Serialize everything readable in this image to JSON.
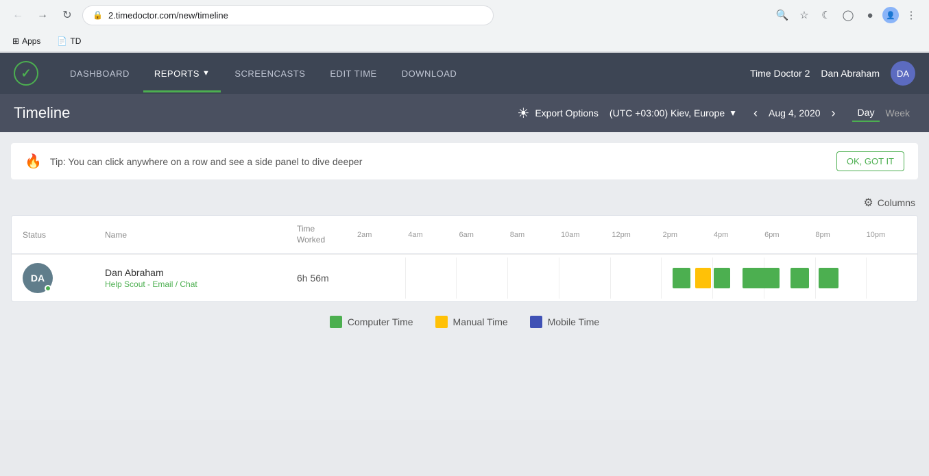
{
  "browser": {
    "url": "2.timedoctor.com/new/timeline",
    "bookmarks": [
      {
        "label": "Apps",
        "icon": "⊞"
      },
      {
        "label": "TD",
        "icon": "📄"
      }
    ],
    "menu_icon": "⋮"
  },
  "header": {
    "logo_check": "✓",
    "nav": [
      {
        "id": "dashboard",
        "label": "DASHBOARD",
        "active": false
      },
      {
        "id": "reports",
        "label": "REPORTS",
        "active": true,
        "has_dropdown": true
      },
      {
        "id": "screencasts",
        "label": "SCREENCASTS",
        "active": false
      },
      {
        "id": "edit_time",
        "label": "EDIT TIME",
        "active": false
      },
      {
        "id": "download",
        "label": "DOWNLOAD",
        "active": false
      }
    ],
    "app_name": "Time Doctor 2",
    "user_name": "Dan Abraham",
    "user_initials": "DA"
  },
  "timeline_header": {
    "title": "Timeline",
    "export_label": "Export Options",
    "timezone": "(UTC +03:00) Kiev, Europe",
    "date": "Aug 4, 2020",
    "views": [
      {
        "label": "Day",
        "active": true
      },
      {
        "label": "Week",
        "active": false
      }
    ]
  },
  "tip": {
    "text": "Tip: You can click anywhere on a row and see a side panel to dive deeper",
    "button_label": "OK, GOT IT",
    "icon": "🔥"
  },
  "columns_button": "Columns",
  "table": {
    "headers": [
      "Status",
      "Name",
      "Time Worked"
    ],
    "time_labels": [
      "2am",
      "4am",
      "6am",
      "8am",
      "10am",
      "12pm",
      "2pm",
      "4pm",
      "6pm",
      "8pm",
      "10pm"
    ],
    "rows": [
      {
        "initials": "DA",
        "name": "Dan Abraham",
        "task": "Help Scout - Email / Chat",
        "time_worked": "6h 56m",
        "status_color": "#607d8b",
        "online": true
      }
    ]
  },
  "legend": [
    {
      "type": "computer",
      "label": "Computer Time"
    },
    {
      "type": "manual",
      "label": "Manual Time"
    },
    {
      "type": "mobile",
      "label": "Mobile Time"
    }
  ],
  "bars": [
    {
      "type": "computer",
      "left_pct": 56.5,
      "width_pct": 3.2
    },
    {
      "type": "manual",
      "left_pct": 60.5,
      "width_pct": 2.8
    },
    {
      "type": "computer",
      "left_pct": 63.8,
      "width_pct": 3.0
    },
    {
      "type": "computer",
      "left_pct": 69.0,
      "width_pct": 6.5
    },
    {
      "type": "computer",
      "left_pct": 77.5,
      "width_pct": 3.2
    },
    {
      "type": "computer",
      "left_pct": 82.5,
      "width_pct": 3.5
    }
  ]
}
